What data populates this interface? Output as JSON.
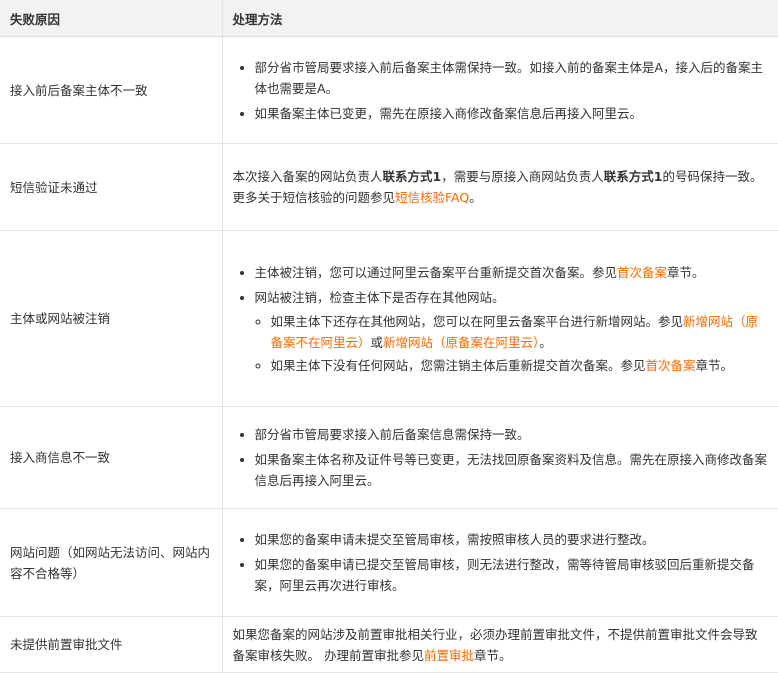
{
  "header": {
    "col1": "失败原因",
    "col2": "处理方法"
  },
  "rows": [
    {
      "reason": "接入前后备案主体不一致",
      "b1": "部分省市管局要求接入前后备案主体需保持一致。如接入前的备案主体是A，接入后的备案主体也需要是A。",
      "b2": "如果备案主体已变更，需先在原接入商修改备案信息后再接入阿里云。"
    },
    {
      "reason": "短信验证未通过",
      "t1": "本次接入备案的网站负责人",
      "bold1": "联系方式1",
      "t2": "，需要与原接入商网站负责人",
      "bold2": "联系方式1",
      "t3": "的号码保持一致。",
      "t4": "更多关于短信核验的问题参见",
      "link": "短信核验FAQ",
      "t5": "。"
    },
    {
      "reason": "主体或网站被注销",
      "b1_text": "主体被注销，您可以通过阿里云备案平台重新提交首次备案。参见",
      "b1_link": "首次备案",
      "b1_end": "章节。",
      "b2_text": "网站被注销，检查主体下是否存在其他网站。",
      "s1_text": "如果主体下还存在其他网站，您可以在阿里云备案平台进行新增网站。参见",
      "s1_link1": "新增网站（原备案不在阿里云）",
      "s1_mid": "或",
      "s1_link2": "新增网站（原备案在阿里云）",
      "s1_end": "。",
      "s2_text": "如果主体下没有任何网站，您需注销主体后重新提交首次备案。参见",
      "s2_link": "首次备案",
      "s2_end": "章节。"
    },
    {
      "reason": "接入商信息不一致",
      "b1": "部分省市管局要求接入前后备案信息需保持一致。",
      "b2": "如果备案主体名称及证件号等已变更，无法找回原备案资料及信息。需先在原接入商修改备案信息后再接入阿里云。"
    },
    {
      "reason": "网站问题（如网站无法访问、网站内容不合格等）",
      "b1": "如果您的备案申请未提交至管局审核，需按照审核人员的要求进行整改。",
      "b2": "如果您的备案申请已提交至管局审核，则无法进行整改，需等待管局审核驳回后重新提交备案，阿里云再次进行审核。"
    },
    {
      "reason": "未提供前置审批文件",
      "t1": "如果您备案的网站涉及前置审批相关行业，必须办理前置审批文件，不提供前置审批文件会导致备案审核失败。 办理前置审批参见",
      "link": "前置审批",
      "t2": "章节。"
    }
  ]
}
